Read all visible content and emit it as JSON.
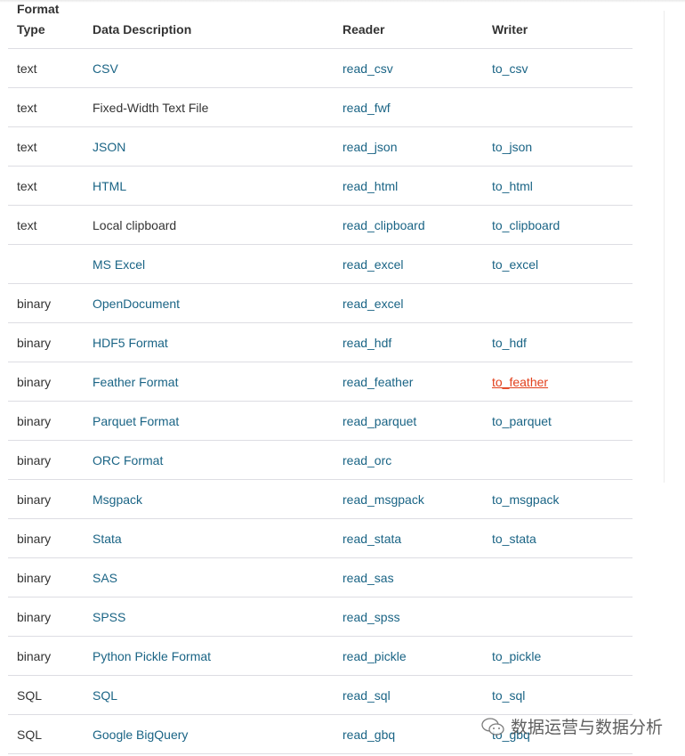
{
  "header": {
    "format_type": [
      "Format",
      "Type"
    ],
    "description": "Data Description",
    "reader": "Reader",
    "writer": "Writer"
  },
  "rows": [
    {
      "type": "text",
      "desc": "CSV",
      "desc_link": true,
      "reader": "read_csv",
      "writer": "to_csv"
    },
    {
      "type": "text",
      "desc": "Fixed-Width Text File",
      "desc_link": false,
      "reader": "read_fwf",
      "writer": ""
    },
    {
      "type": "text",
      "desc": "JSON",
      "desc_link": true,
      "reader": "read_json",
      "writer": "to_json"
    },
    {
      "type": "text",
      "desc": "HTML",
      "desc_link": true,
      "reader": "read_html",
      "writer": "to_html"
    },
    {
      "type": "text",
      "desc": "Local clipboard",
      "desc_link": false,
      "reader": "read_clipboard",
      "writer": "to_clipboard"
    },
    {
      "type": "",
      "desc": "MS Excel",
      "desc_link": true,
      "reader": "read_excel",
      "writer": "to_excel"
    },
    {
      "type": "binary",
      "desc": "OpenDocument",
      "desc_link": true,
      "reader": "read_excel",
      "writer": ""
    },
    {
      "type": "binary",
      "desc": "HDF5 Format",
      "desc_link": true,
      "reader": "read_hdf",
      "writer": "to_hdf"
    },
    {
      "type": "binary",
      "desc": "Feather Format",
      "desc_link": true,
      "reader": "read_feather",
      "writer": "to_feather",
      "writer_hover": true
    },
    {
      "type": "binary",
      "desc": "Parquet Format",
      "desc_link": true,
      "reader": "read_parquet",
      "writer": "to_parquet"
    },
    {
      "type": "binary",
      "desc": "ORC Format",
      "desc_link": true,
      "reader": "read_orc",
      "writer": ""
    },
    {
      "type": "binary",
      "desc": "Msgpack",
      "desc_link": true,
      "reader": "read_msgpack",
      "writer": "to_msgpack"
    },
    {
      "type": "binary",
      "desc": "Stata",
      "desc_link": true,
      "reader": "read_stata",
      "writer": "to_stata"
    },
    {
      "type": "binary",
      "desc": "SAS",
      "desc_link": true,
      "reader": "read_sas",
      "writer": ""
    },
    {
      "type": "binary",
      "desc": "SPSS",
      "desc_link": true,
      "reader": "read_spss",
      "writer": ""
    },
    {
      "type": "binary",
      "desc": "Python Pickle Format",
      "desc_link": true,
      "reader": "read_pickle",
      "writer": "to_pickle"
    },
    {
      "type": "SQL",
      "desc": "SQL",
      "desc_link": true,
      "reader": "read_sql",
      "writer": "to_sql"
    },
    {
      "type": "SQL",
      "desc": "Google BigQuery",
      "desc_link": true,
      "reader": "read_gbq",
      "writer": "to_gbq"
    }
  ],
  "watermark": {
    "text": "数据运营与数据分析",
    "icon": "wechat-icon"
  },
  "colors": {
    "link": "#1a6485",
    "hover_link": "#e2401c",
    "text": "#333333",
    "border": "#dddde3"
  }
}
